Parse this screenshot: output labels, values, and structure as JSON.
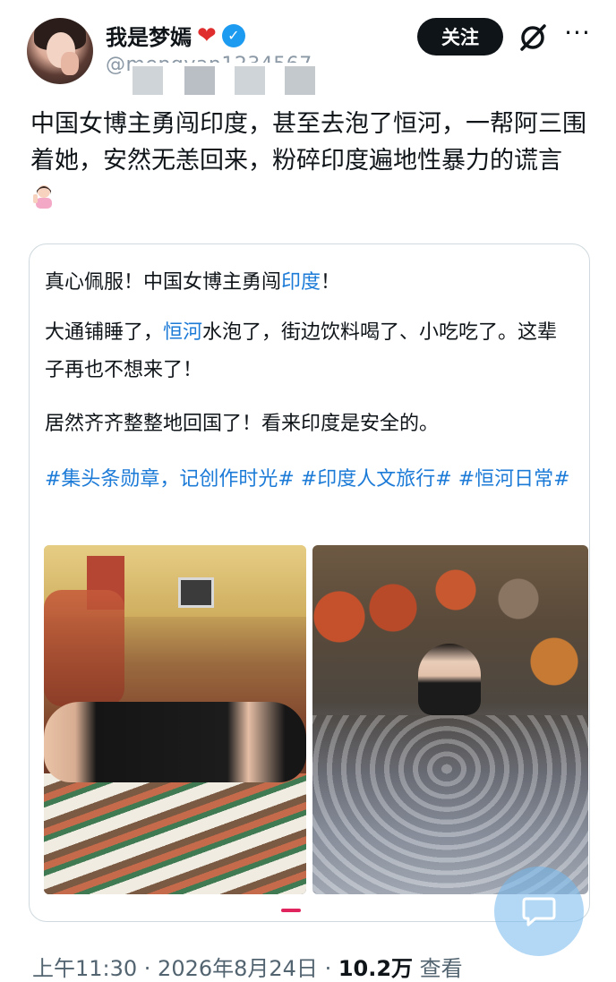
{
  "header": {
    "display_name": "我是梦嫣",
    "heart": "❤",
    "verified_mark": "✓",
    "handle": "@mengyan1234567",
    "follow_label": "关注",
    "more_label": "···"
  },
  "post": {
    "text": "中国女博主勇闯印度，甚至去泡了恒河，一帮阿三围着她，安然无恙回来，粉碎印度遍地性暴力的谎言"
  },
  "quoted": {
    "line1_prefix": "真心佩服！中国女博主勇闯",
    "line1_link": "印度",
    "line1_suffix": "！",
    "line2_prefix": "大通铺睡了，",
    "line2_link": "恒河",
    "line2_suffix": "水泡了，街边饮料喝了、小吃吃了。这辈子再也不想来了！",
    "line3": "居然齐齐整整地回国了！看来印度是安全的。",
    "hashtags": "#集头条勋章，记创作时光# #印度人文旅行# #恒河日常#"
  },
  "footer": {
    "time": "上午11:30 · 2026年8月24日 · ",
    "views_count": "10.2万",
    "views_label": " 查看"
  },
  "colors": {
    "link": "#1d7bd8",
    "verified": "#1d9bf0",
    "pager_active": "#e0245e"
  },
  "icons": [
    "verified-icon",
    "grok-icon",
    "more-icon",
    "woman-gesturing-emoji",
    "reply-fab-icon"
  ]
}
